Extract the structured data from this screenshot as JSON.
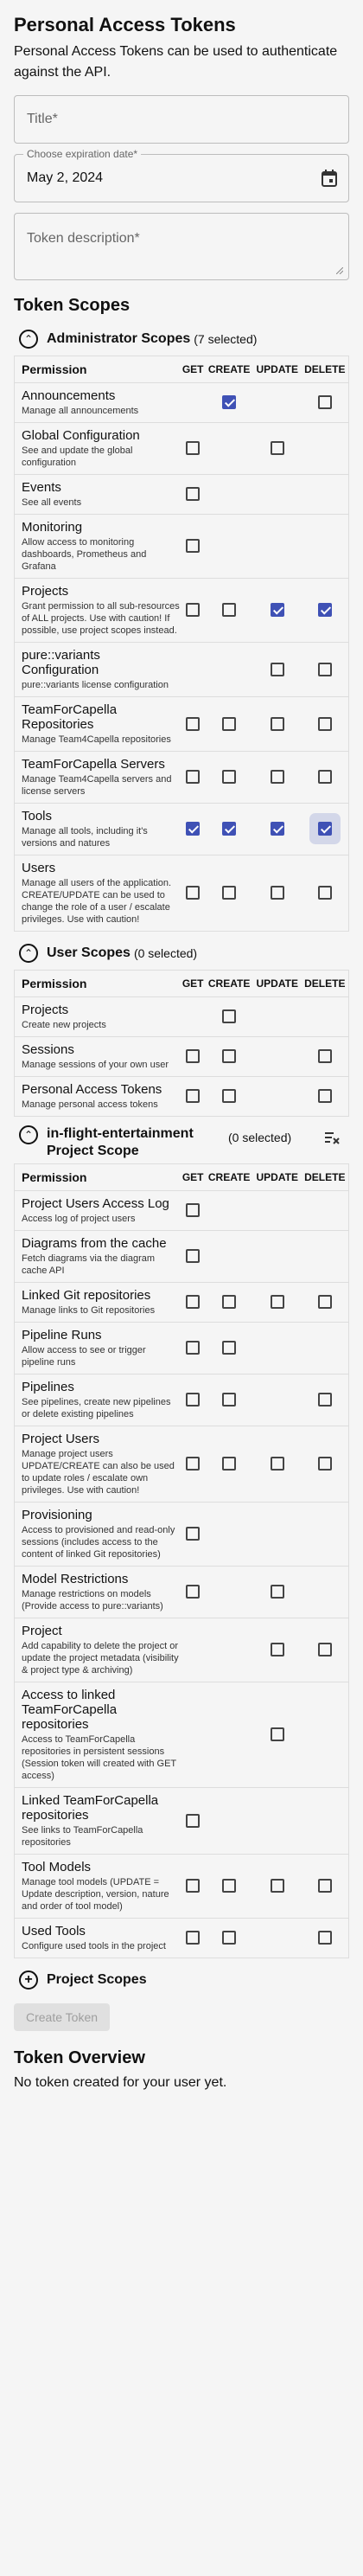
{
  "header": {
    "title": "Personal Access Tokens",
    "description": "Personal Access Tokens can be used to authenticate against the API."
  },
  "form": {
    "title_placeholder": "Title*",
    "expiration_label": "Choose expiration date*",
    "expiration_value": "May 2, 2024",
    "description_placeholder": "Token description*"
  },
  "token_scopes": {
    "heading": "Token Scopes",
    "columns": [
      "Permission",
      "GET",
      "CREATE",
      "UPDATE",
      "DELETE"
    ],
    "admin": {
      "name": "Administrator Scopes",
      "count": "(7 selected)",
      "rows": [
        {
          "name": "Announcements",
          "desc": "Manage all announcements",
          "cells": [
            "",
            "checked",
            "",
            "empty"
          ]
        },
        {
          "name": "Global Configuration",
          "desc": "See and update the global configuration",
          "cells": [
            "empty",
            "",
            "empty",
            ""
          ]
        },
        {
          "name": "Events",
          "desc": "See all events",
          "cells": [
            "empty",
            "",
            "",
            ""
          ]
        },
        {
          "name": "Monitoring",
          "desc": "Allow access to monitoring dashboards, Prometheus and Grafana",
          "cells": [
            "empty",
            "",
            "",
            ""
          ]
        },
        {
          "name": "Projects",
          "desc": "Grant permission to all sub-resources of ALL projects. Use with caution! If possible, use project scopes instead.",
          "cells": [
            "empty",
            "empty",
            "checked",
            "checked"
          ]
        },
        {
          "name": "pure::variants Configuration",
          "desc": "pure::variants license configuration",
          "cells": [
            "",
            "",
            "empty",
            "empty"
          ]
        },
        {
          "name": "TeamForCapella Repositories",
          "desc": "Manage Team4Capella repositories",
          "cells": [
            "empty",
            "empty",
            "empty",
            "empty"
          ]
        },
        {
          "name": "TeamForCapella Servers",
          "desc": "Manage Team4Capella servers and license servers",
          "cells": [
            "empty",
            "empty",
            "empty",
            "empty"
          ]
        },
        {
          "name": "Tools",
          "desc": "Manage all tools, including it's versions and natures",
          "cells": [
            "checked",
            "checked",
            "checked",
            "checked-focus"
          ]
        },
        {
          "name": "Users",
          "desc": "Manage all users of the application. CREATE/UPDATE can be used to change the role of a user / escalate privileges. Use with caution!",
          "cells": [
            "empty",
            "empty",
            "empty",
            "empty"
          ]
        }
      ]
    },
    "user": {
      "name": "User Scopes",
      "count": "(0 selected)",
      "rows": [
        {
          "name": "Projects",
          "desc": "Create new projects",
          "cells": [
            "",
            "empty",
            "",
            ""
          ]
        },
        {
          "name": "Sessions",
          "desc": "Manage sessions of your own user",
          "cells": [
            "empty",
            "empty",
            "",
            "empty"
          ]
        },
        {
          "name": "Personal Access Tokens",
          "desc": "Manage personal access tokens",
          "cells": [
            "empty",
            "empty",
            "",
            "empty"
          ]
        }
      ]
    },
    "project": {
      "name": "in-flight-entertainment Project Scope",
      "count": "(0 selected)",
      "rows": [
        {
          "name": "Project Users Access Log",
          "desc": "Access log of project users",
          "cells": [
            "empty",
            "",
            "",
            ""
          ]
        },
        {
          "name": "Diagrams from the cache",
          "desc": "Fetch diagrams via the diagram cache API",
          "cells": [
            "empty",
            "",
            "",
            ""
          ]
        },
        {
          "name": "Linked Git repositories",
          "desc": "Manage links to Git repositories",
          "cells": [
            "empty",
            "empty",
            "empty",
            "empty"
          ]
        },
        {
          "name": "Pipeline Runs",
          "desc": "Allow access to see or trigger pipeline runs",
          "cells": [
            "empty",
            "empty",
            "",
            ""
          ]
        },
        {
          "name": "Pipelines",
          "desc": "See pipelines, create new pipelines or delete existing pipelines",
          "cells": [
            "empty",
            "empty",
            "",
            "empty"
          ]
        },
        {
          "name": "Project Users",
          "desc": "Manage project users UPDATE/CREATE can also be used to update roles / escalate own privileges. Use with caution!",
          "cells": [
            "empty",
            "empty",
            "empty",
            "empty"
          ]
        },
        {
          "name": "Provisioning",
          "desc": "Access to provisioned and read-only sessions (includes access to the content of linked Git repositories)",
          "cells": [
            "empty",
            "",
            "",
            ""
          ]
        },
        {
          "name": "Model Restrictions",
          "desc": "Manage restrictions on models (Provide access to pure::variants)",
          "cells": [
            "empty",
            "",
            "empty",
            ""
          ]
        },
        {
          "name": "Project",
          "desc": "Add capability to delete the project or update the project metadata (visibility & project type & archiving)",
          "cells": [
            "",
            "",
            "empty",
            "empty"
          ]
        },
        {
          "name": "Access to linked TeamForCapella repositories",
          "desc": "Access to TeamForCapella repositories in persistent sessions (Session token will created with GET access)",
          "cells": [
            "",
            "",
            "empty",
            ""
          ]
        },
        {
          "name": "Linked TeamForCapella repositories",
          "desc": "See links to TeamForCapella repositories",
          "cells": [
            "empty",
            "",
            "",
            ""
          ]
        },
        {
          "name": "Tool Models",
          "desc": "Manage tool models (UPDATE = Update description, version, nature and order of tool model)",
          "cells": [
            "empty",
            "empty",
            "empty",
            "empty"
          ]
        },
        {
          "name": "Used Tools",
          "desc": "Configure used tools in the project",
          "cells": [
            "empty",
            "empty",
            "",
            "empty"
          ]
        }
      ]
    },
    "add_project_scopes": "Project Scopes"
  },
  "create_button": "Create Token",
  "overview": {
    "heading": "Token Overview",
    "empty_text": "No token created for your user yet."
  },
  "colors": {
    "accent": "#3f51b5",
    "background": "#f5f5f5"
  }
}
